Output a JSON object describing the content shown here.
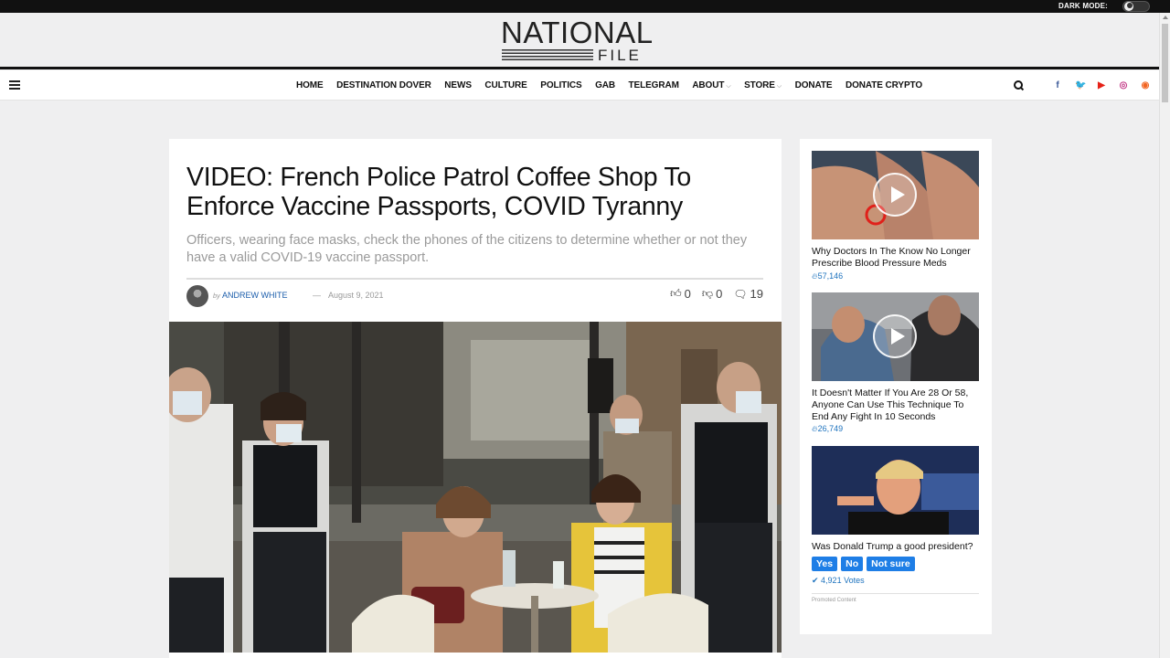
{
  "topbar": {
    "dark_mode_label": "DARK MODE:"
  },
  "logo": {
    "line1": "NATIONAL",
    "line2": "FILE"
  },
  "nav": {
    "items": [
      {
        "label": "HOME",
        "has_dropdown": false
      },
      {
        "label": "DESTINATION DOVER",
        "has_dropdown": false
      },
      {
        "label": "NEWS",
        "has_dropdown": false
      },
      {
        "label": "CULTURE",
        "has_dropdown": false
      },
      {
        "label": "POLITICS",
        "has_dropdown": false
      },
      {
        "label": "GAB",
        "has_dropdown": false
      },
      {
        "label": "TELEGRAM",
        "has_dropdown": false
      },
      {
        "label": "ABOUT",
        "has_dropdown": true
      },
      {
        "label": "STORE",
        "has_dropdown": true
      },
      {
        "label": "DONATE",
        "has_dropdown": false
      },
      {
        "label": "DONATE CRYPTO",
        "has_dropdown": false
      }
    ],
    "social_icons": [
      {
        "name": "facebook-icon",
        "glyph": "f",
        "color": "#3b5998"
      },
      {
        "name": "twitter-icon",
        "glyph": "🐦",
        "color": "#1da1f2"
      },
      {
        "name": "youtube-icon",
        "glyph": "▶",
        "color": "#e62117"
      },
      {
        "name": "instagram-icon",
        "glyph": "◎",
        "color": "#c13584"
      },
      {
        "name": "rss-icon",
        "glyph": "◉",
        "color": "#f26522"
      }
    ]
  },
  "article": {
    "title": "VIDEO: French Police Patrol Coffee Shop To Enforce Vaccine Passports, COVID Tyranny",
    "subtitle": "Officers, wearing face masks, check the phones of the citizens to determine whether or not they have a valid COVID-19 vaccine passport.",
    "by": "by",
    "author": "ANDREW WHITE",
    "separator": "—",
    "date": "August 9, 2021",
    "likes": "0",
    "dislikes": "0",
    "comments": "19"
  },
  "sidebar": {
    "ads": [
      {
        "headline": "Why Doctors In The Know No Longer Prescribe Blood Pressure Meds",
        "count": "57,146",
        "has_play": true
      },
      {
        "headline": "It Doesn't Matter If You Are 28 Or 58, Anyone Can Use This Technique To End Any Fight In 10 Seconds",
        "count": "26,749",
        "has_play": true
      }
    ],
    "poll": {
      "question": "Was Donald Trump a good president?",
      "options": [
        "Yes",
        "No",
        "Not sure"
      ],
      "votes": "4,921 Votes"
    },
    "promoted_label": "Promoted Content"
  }
}
